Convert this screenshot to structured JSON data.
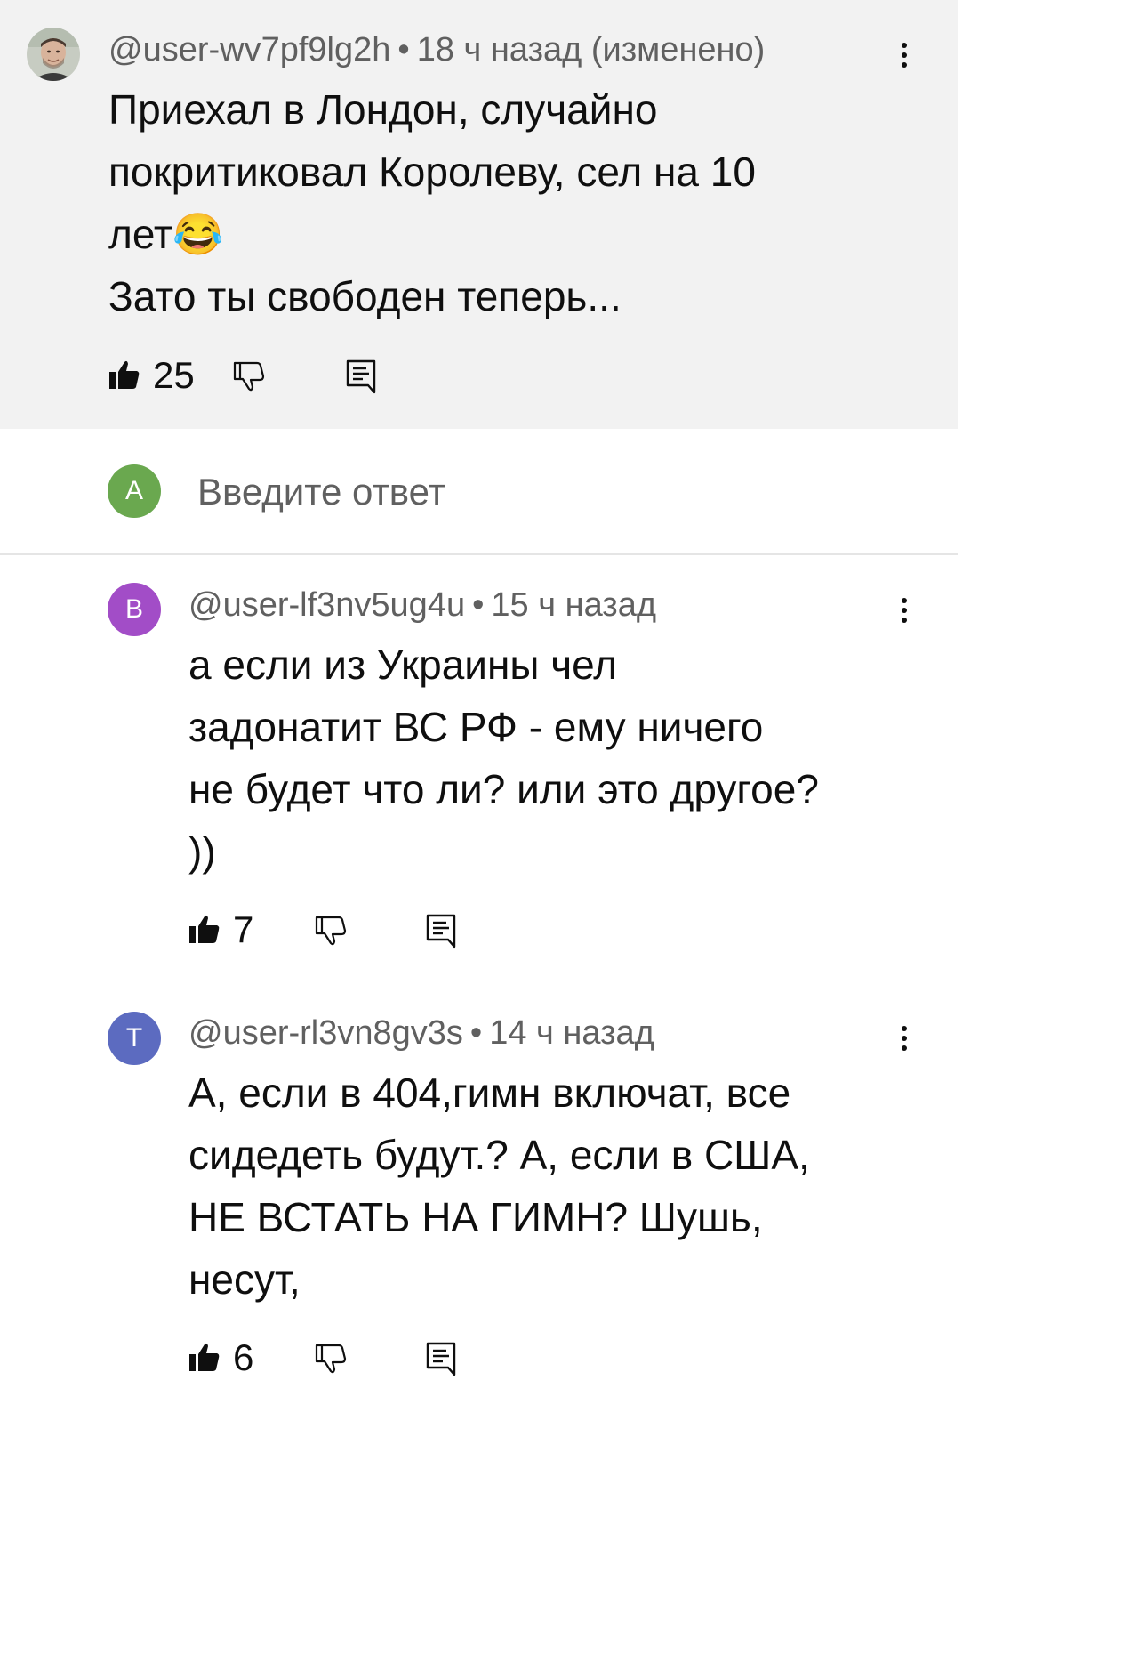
{
  "original_comment": {
    "author": "@user-wv7pf9lg2h",
    "separator": "•",
    "time": "18 ч назад (изменено)",
    "text_lines": [
      "Приехал в Лондон, случайно",
      "покритиковал Королеву, сел на 10",
      "лет😂",
      "Зато ты свободен теперь..."
    ],
    "likes": "25"
  },
  "reply_box": {
    "avatar_letter": "A",
    "avatar_color": "#6aa84f",
    "placeholder": "Введите ответ"
  },
  "replies": [
    {
      "avatar_letter": "B",
      "avatar_color": "#a24dc7",
      "author": "@user-lf3nv5ug4u",
      "separator": "•",
      "time": "15 ч назад",
      "text_lines": [
        "а если из Украины чел",
        "задонатит ВС РФ - ему ничего",
        "не будет что ли? или это другое?",
        "))"
      ],
      "likes": "7"
    },
    {
      "avatar_letter": "T",
      "avatar_color": "#5c6bc0",
      "author": "@user-rl3vn8gv3s",
      "separator": "•",
      "time": "14 ч назад",
      "text_lines": [
        "А, если в 404,гимн включат, все",
        "сидедеть будут.? А, если в США,",
        "НЕ ВСТАТЬ НА ГИМН? Шушь,",
        "несут,"
      ],
      "likes": "6"
    }
  ],
  "icons": {
    "like": "thumbs-up-icon",
    "dislike": "thumbs-down-icon",
    "reply": "reply-comment-icon",
    "menu": "more-vertical-icon"
  }
}
